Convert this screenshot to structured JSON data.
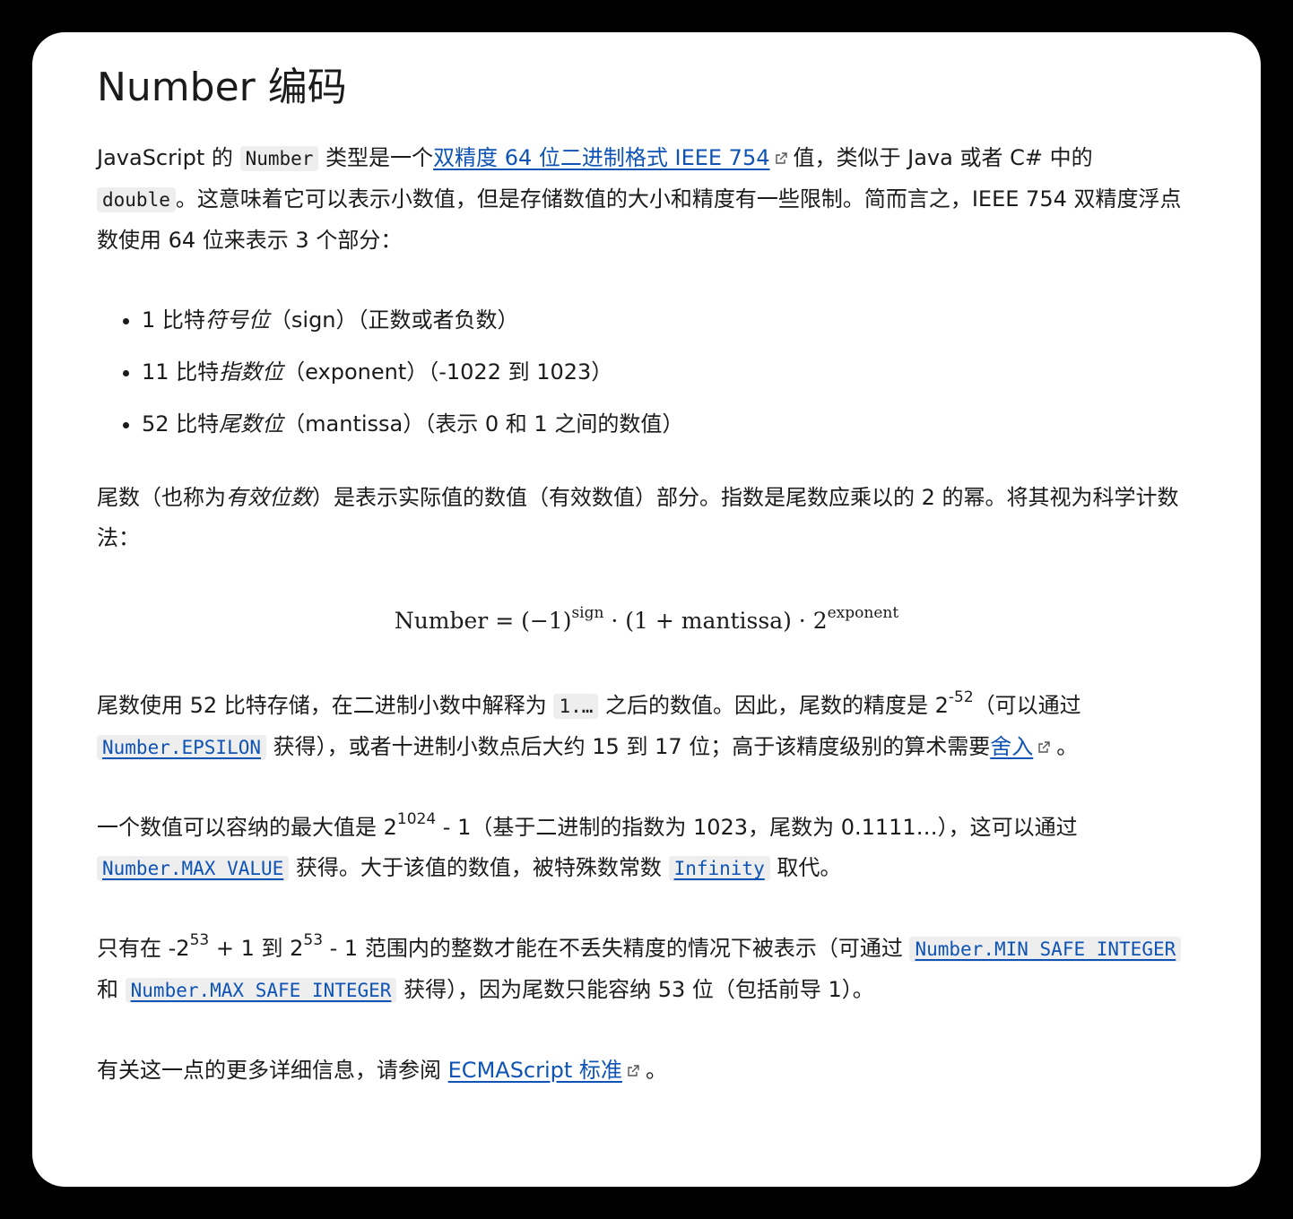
{
  "heading": "Number 编码",
  "p1": {
    "t1": "JavaScript 的 ",
    "code1": "Number",
    "t2": " 类型是一个",
    "link1": "双精度 64 位二进制格式 IEEE 754",
    "t3": "值，类似于 Java 或者 C# 中的 ",
    "code2": "double",
    "t4": "。这意味着它可以表示小数值，但是存储数值的大小和精度有一些限制。简而言之，IEEE 754 双精度浮点数使用 64 位来表示 3 个部分："
  },
  "list": [
    {
      "pre": "1 比特",
      "em": "符号位",
      "post": "（sign）（正数或者负数）"
    },
    {
      "pre": "11 比特",
      "em": "指数位",
      "post": "（exponent）（-1022 到 1023）"
    },
    {
      "pre": "52 比特",
      "em": "尾数位",
      "post": "（mantissa）（表示 0 和 1 之间的数值）"
    }
  ],
  "p2": {
    "t1": "尾数（也称为",
    "em": "有效位数",
    "t2": "）是表示实际值的数值（有效数值）部分。指数是尾数应乘以的 2 的幂。将其视为科学计数法："
  },
  "formula": {
    "lhs": "Number = (−1)",
    "sup1": "sign",
    "mid": " · (1 + mantissa) · 2",
    "sup2": "exponent"
  },
  "p3": {
    "t1": "尾数使用 52 比特存储，在二进制小数中解释为 ",
    "code1": "1.…",
    "t2": " 之后的数值。因此，尾数的精度是 2",
    "sup1": "-52",
    "t3": "（可以通过 ",
    "code2": "Number.EPSILON",
    "t4": " 获得），或者十进制小数点后大约 15 到 17 位；高于该精度级别的算术需要",
    "link1": "舍入",
    "t5": "。"
  },
  "p4": {
    "t1": "一个数值可以容纳的最大值是 2",
    "sup1": "1024",
    "t2": " - 1（基于二进制的指数为 1023，尾数为 0.1111…），这可以通过 ",
    "code1": "Number.MAX_VALUE",
    "t3": " 获得。大于该值的数值，被特殊数常数 ",
    "code2": "Infinity",
    "t4": " 取代。"
  },
  "p5": {
    "t1": "只有在 -2",
    "sup1": "53",
    "t2": " + 1 到 2",
    "sup2": "53",
    "t3": " - 1 范围内的整数才能在不丢失精度的情况下被表示（可通过 ",
    "code1": "Number.MIN_SAFE_INTEGER",
    "t4": " 和 ",
    "code2": "Number.MAX_SAFE_INTEGER",
    "t5": " 获得），因为尾数只能容纳 53 位（包括前导 1）。"
  },
  "p6": {
    "t1": "有关这一点的更多详细信息，请参阅 ",
    "link1": "ECMAScript 标准",
    "t2": "。"
  },
  "icons": {
    "external": "external-link-icon"
  },
  "colors": {
    "link": "#0f54b4",
    "text": "#1b1b1b",
    "code_bg": "#eeeeee"
  }
}
